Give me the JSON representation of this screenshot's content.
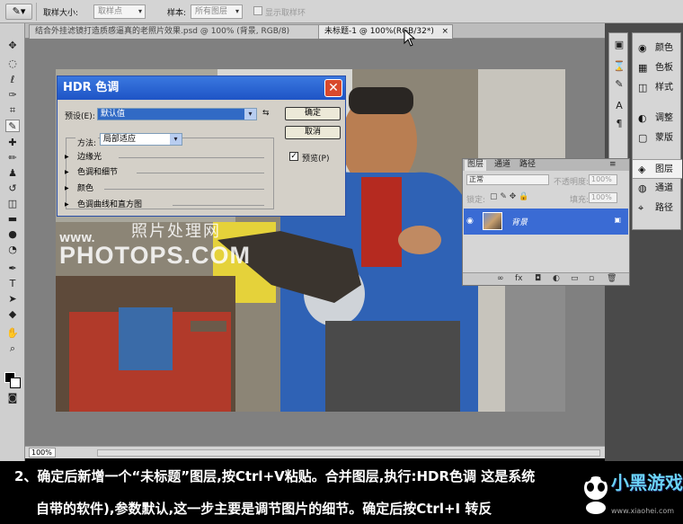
{
  "options_bar": {
    "tool_icon": "eyedropper-icon",
    "sample_size_label": "取样大小:",
    "sample_size_value": "取样点",
    "sample_label": "样本:",
    "sample_value": "所有图层",
    "show_ring_label": "显示取样环"
  },
  "doc_tabs": [
    {
      "label": "结合外挂滤镜打造质感逼真的老照片效果.psd @ 100% (背景, RGB/8)",
      "close": "×",
      "active": false
    },
    {
      "label": "未标题-1 @ 100%(RGB/32*)",
      "close": "×",
      "active": true
    }
  ],
  "hdr_dialog": {
    "title": "HDR 色调",
    "close": "✕",
    "preset_label": "预设(E):",
    "preset_value": "默认值",
    "ok": "确定",
    "cancel": "取消",
    "preview_label": "预览(P)",
    "preview_checked": true,
    "method_label": "方法:",
    "method_value": "局部适应",
    "sections": [
      "边缘光",
      "色调和细节",
      "颜色",
      "色调曲线和直方图"
    ]
  },
  "watermark": {
    "cn": "照片处理网",
    "www": "WWW.",
    "en": "PHOTOPS.COM"
  },
  "status": {
    "zoom": "100%"
  },
  "right_panels": [
    {
      "icon": "palette-icon",
      "label": "颜色",
      "active": false
    },
    {
      "icon": "swatches-icon",
      "label": "色板",
      "active": false
    },
    {
      "icon": "styles-icon",
      "label": "样式",
      "active": false
    },
    {
      "icon": "adjust-icon",
      "label": "调整",
      "active": false
    },
    {
      "icon": "mask-icon",
      "label": "蒙版",
      "active": false
    },
    {
      "icon": "layers-icon",
      "label": "图层",
      "active": true
    },
    {
      "icon": "channels-icon",
      "label": "通道",
      "active": false
    },
    {
      "icon": "paths-icon",
      "label": "路径",
      "active": false
    }
  ],
  "layers_panel": {
    "tabs": [
      "图层",
      "通道",
      "路径"
    ],
    "blend_mode": "正常",
    "opacity_label": "不透明度:",
    "opacity_value": "100%",
    "lock_label": "锁定:",
    "fill_label": "填充:",
    "fill_value": "100%",
    "layer_name": "背景"
  },
  "caption": {
    "line1": "2、确定后新增一个“未标题”图层,按Ctrl+V粘贴。合并图层,执行:HDR色调 这是系统",
    "line2": "自带的软件),参数默认,这一步主要是调节图片的细节。确定后按Ctrl+I 转反"
  },
  "brand": {
    "name": "小黑游戏",
    "url": "www.xiaohei.com"
  },
  "colors": {
    "dialog_title": "#1e54c6",
    "layer_selected": "#3a6bd4",
    "caption_bg": "#000000"
  }
}
